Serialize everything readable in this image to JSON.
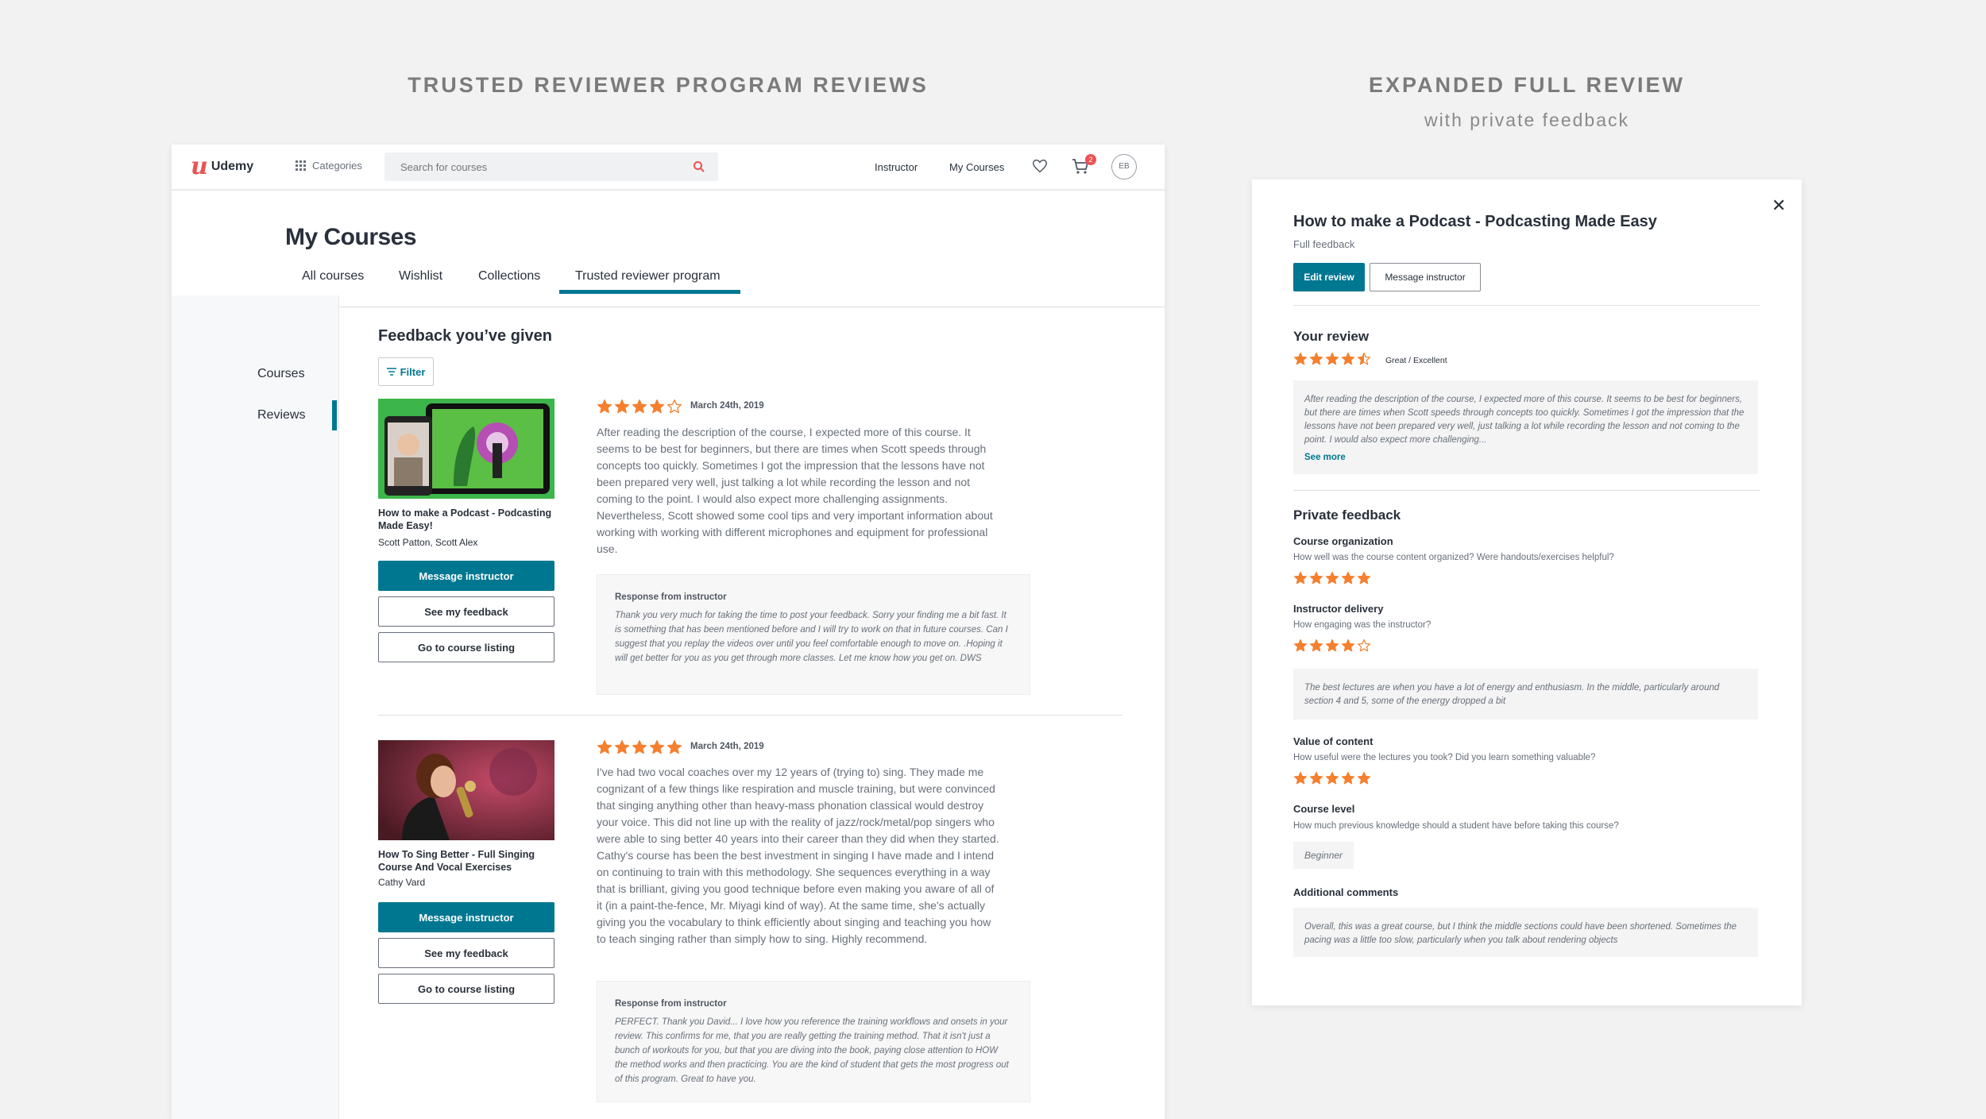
{
  "headings": {
    "left_title": "TRUSTED REVIEWER PROGRAM REVIEWS",
    "right_title": "EXPANDED FULL REVIEW",
    "right_subtitle": "with private feedback"
  },
  "colors": {
    "accent": "#007791",
    "brand": "#ec5252",
    "star": "#f4802f"
  },
  "header": {
    "logo": "Udemy",
    "categories": "Categories",
    "search_placeholder": "Search for courses",
    "instructor": "Instructor",
    "my_courses": "My Courses",
    "cart_count": "2",
    "avatar": "EB",
    "icons": [
      "grid-icon",
      "search-icon",
      "heart-icon",
      "cart-icon"
    ]
  },
  "page": {
    "title": "My Courses",
    "tabs": [
      "All courses",
      "Wishlist",
      "Collections",
      "Trusted reviewer program"
    ],
    "active_tab": "Trusted reviewer program",
    "sidebar": [
      "Courses",
      "Reviews"
    ],
    "active_sidebar": "Reviews"
  },
  "feedback": {
    "title": "Feedback you’ve given",
    "filter": "Filter",
    "reviews": [
      {
        "course": "How to make a Podcast - Podcasting Made Easy!",
        "authors": "Scott Patton, Scott Alex",
        "rating": 4,
        "date": "March 24th, 2019",
        "text": "After reading the description of the course, I expected more of this course. It seems to be best for beginners, but there are times when Scott speeds through concepts too quickly. Sometimes I got the impression that the lessons have not been prepared very well, just talking a lot while recording the lesson and not coming to the point. I would also expect more challenging assignments. Nevertheless, Scott showed some cool tips and very important information about working with working with different microphones and equipment for professional use.",
        "response_heading": "Response from instructor",
        "response": "Thank you very much for taking the time to post your feedback. Sorry your finding me a bit fast. It is something that has been mentioned before and I will try to work on that in future courses. Can I suggest that you replay the videos over until you feel comfortable enough to move on. .Hoping it will get better for you as you get through more classes. Let me know how you get on. DWS",
        "buttons": [
          "Message instructor",
          "See my feedback",
          "Go to course listing"
        ]
      },
      {
        "course": "How To Sing Better - Full Singing Course And Vocal Exercises",
        "authors": "Cathy Vard",
        "rating": 5,
        "date": "March 24th, 2019",
        "text": "I've had two vocal coaches over my 12 years of (trying to) sing. They made me cognizant of a few things like respiration and muscle training, but were convinced that singing anything other than heavy-mass phonation classical would destroy your voice. This did not line up with the reality of jazz/rock/metal/pop singers who were able to sing better 40 years into their career than they did when they started. Cathy's course has been the best investment in singing I have made and I intend on continuing to train with this methodology. She sequences everything in a way that is brilliant, giving you good technique before even making you aware of all of it (in a paint-the-fence, Mr. Miyagi kind of way). At the same time, she's actually giving you the vocabulary to think efficiently about singing and teaching you how to teach singing rather than simply how to sing. Highly recommend.",
        "response_heading": "Response from instructor",
        "response": "PERFECT. Thank you David... I love how you reference the training workflows and onsets in your review. This confirms for me, that you are really getting the training method. That it isn't just a bunch of workouts for you, but that you are diving into the book, paying close attention to HOW the method works and then practicing. You are the kind of student that gets the most progress out of this program. Great to have you.",
        "buttons": [
          "Message instructor",
          "See my feedback",
          "Go to course listing"
        ]
      }
    ]
  },
  "modal": {
    "title": "How to make a Podcast - Podcasting Made Easy",
    "subtitle": "Full feedback",
    "edit": "Edit review",
    "message": "Message instructor",
    "close_icon": "close-icon",
    "your_review": "Your review",
    "review_rating": 4.5,
    "rating_label": "Great / Excellent",
    "review_excerpt": "After reading the description of the course, I expected more of this course. It seems to be best for beginners, but there are times when Scott speeds through concepts too quickly. Sometimes I got the impression that the lessons have not been prepared very well, just talking a lot while recording the lesson and not coming to the point. I would also expect more challenging...",
    "see_more": "See more",
    "private_feedback": "Private feedback",
    "items": [
      {
        "label": "Course organization",
        "question": "How well was the course content organized? Were handouts/exercises helpful?",
        "rating": 5
      },
      {
        "label": "Instructor delivery",
        "question": "How engaging was the instructor?",
        "rating": 4,
        "comment": "The best lectures are when you have a lot of energy and enthusiasm. In the middle, particularly around section 4 and 5, some of the energy dropped a bit"
      },
      {
        "label": "Value of content",
        "question": "How useful were the lectures you took? Did you learn something valuable?",
        "rating": 5
      }
    ],
    "course_level": "Course level",
    "course_level_q": "How much previous knowledge should a student have before taking this course?",
    "course_level_value": "Beginner",
    "additional": "Additional comments",
    "additional_text": "Overall, this was a great course, but I think the middle sections could have been shortened. Sometimes the pacing was a little too slow, particularly when you talk about rendering objects"
  }
}
